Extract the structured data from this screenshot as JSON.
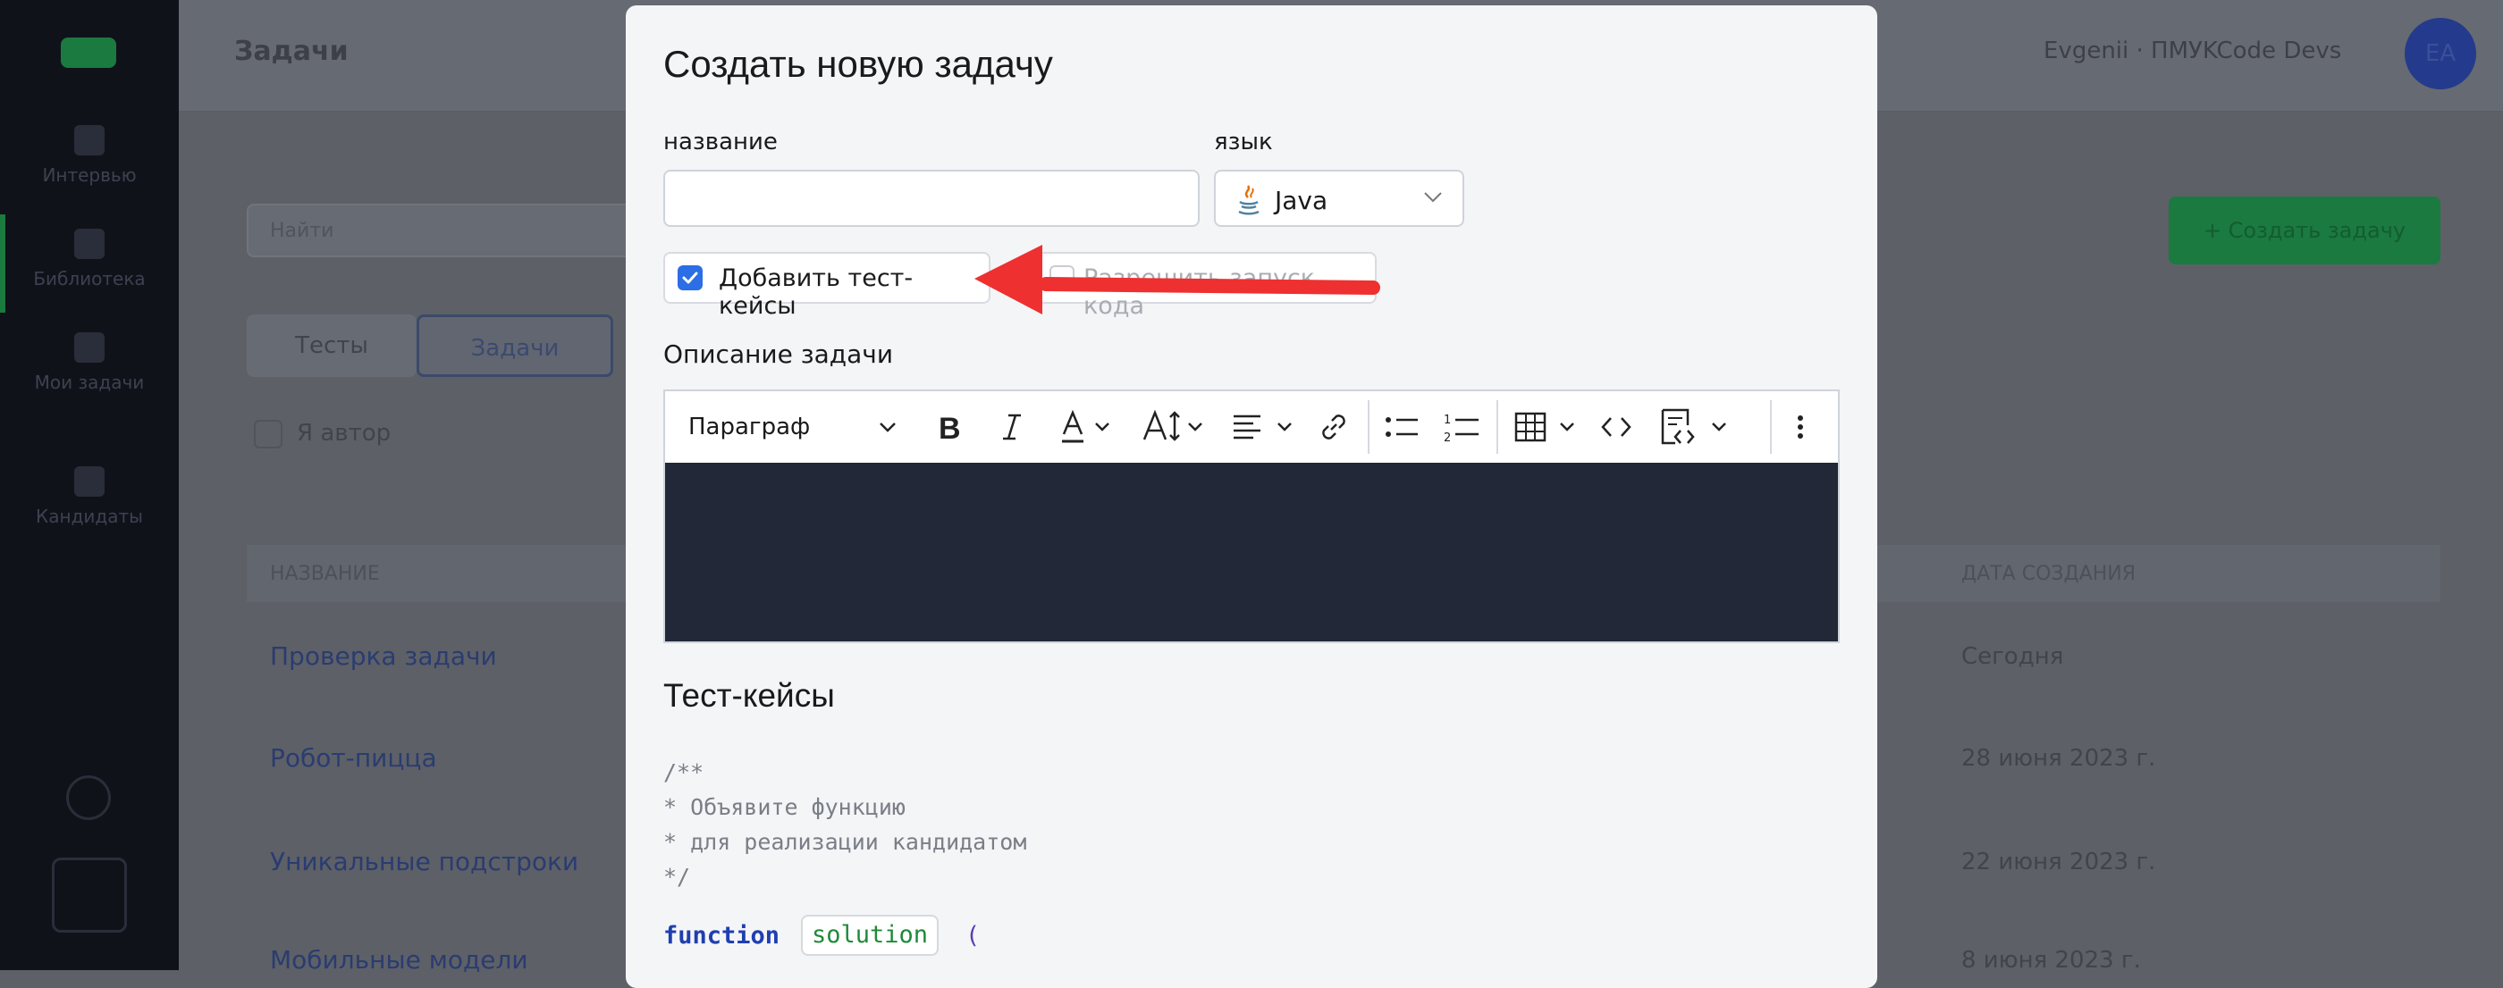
{
  "background": {
    "breadcrumb": "Задачи",
    "user_name": "Evgenii · ПМУKCode Devs",
    "user_initials": "ЕА",
    "sidebar_items": [
      "Интервью",
      "Библиотека",
      "Мои задачи",
      "Кандидаты"
    ],
    "search_placeholder": "Найти",
    "create_button": "+ Создать задачу",
    "tabs": [
      "Тесты",
      "Задачи"
    ],
    "only_mine_label": "Я автор",
    "table_headers": [
      "НАЗВАНИЕ",
      "ДАТА СОЗДАНИЯ"
    ],
    "rows": [
      {
        "name": "Проверка задачи",
        "date": "Сегодня"
      },
      {
        "name": "Робот-пицца",
        "date": "28 июня 2023 г."
      },
      {
        "name": "Уникальные подстроки",
        "date": "22 июня 2023 г."
      },
      {
        "name": "Мобильные модели",
        "date": "8 июня 2023 г."
      }
    ]
  },
  "modal": {
    "title": "Создать новую задачу",
    "name_label": "название",
    "name_value": "",
    "language_label": "язык",
    "language_value": "Java",
    "add_testcases_label": "Добавить тест-кейсы",
    "add_testcases_checked": true,
    "allow_run_label": "Разрешить запуск кода",
    "allow_run_checked": false,
    "description_label": "Описание задачи",
    "editor": {
      "paragraph_style": "Параграф"
    },
    "testcases_title": "Тест-кейсы",
    "code_comment": [
      "/**",
      "* Объявите функцию",
      "* для реализации кандидатом",
      "*/"
    ],
    "code_keyword": "function",
    "code_function_name": "solution",
    "code_paren": "("
  },
  "colors": {
    "accent_blue": "#2b6ee6",
    "arrow_red": "#ee3030",
    "editor_bg": "#232838",
    "keyword": "#1f3fb0",
    "function_name": "#1e8a3a"
  }
}
